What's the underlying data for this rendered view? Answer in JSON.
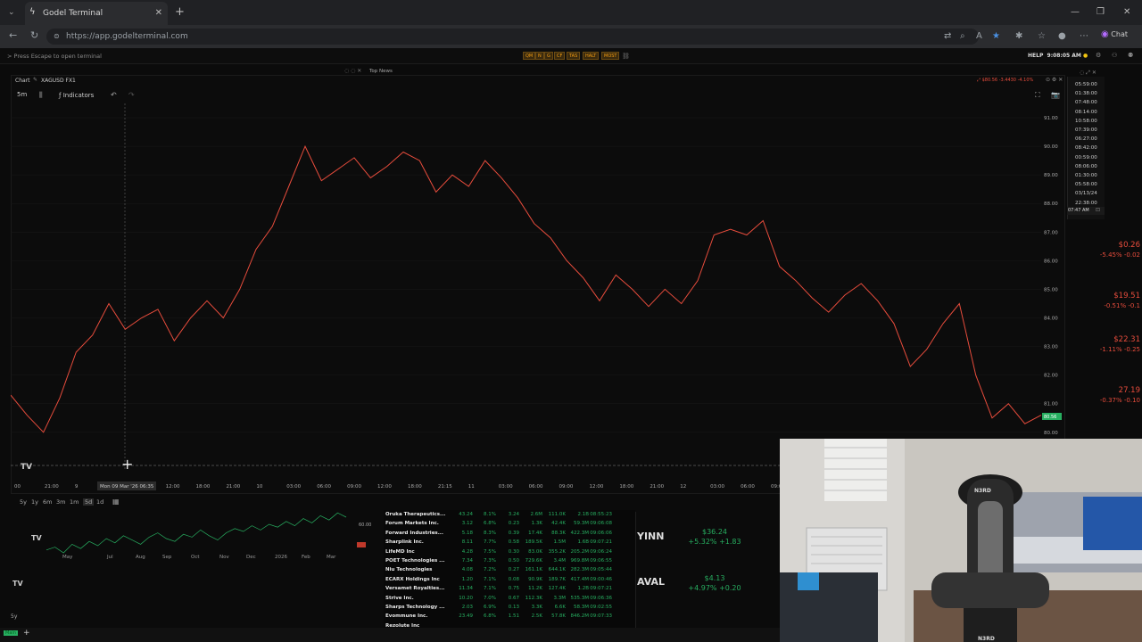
{
  "browser": {
    "tab_title": "Godel Terminal",
    "url": "https://app.godelterminal.com",
    "chat_label": "Chat"
  },
  "terminal": {
    "escape_hint": "Press Escape to open terminal",
    "toolbar_buttons": [
      "QM",
      "N",
      "G",
      "CF",
      "TAS",
      "HALT",
      "MOST"
    ],
    "help_label": "HELP",
    "clock": "9:08:05 AM",
    "top_news_label": "Top News"
  },
  "chart": {
    "panel_title": "Chart",
    "symbol": "XAGUSD FX1",
    "quote": "$80.56 -3.4430 -4.10%",
    "interval": "5m",
    "indicators_label": "Indicators",
    "crosshair_label": "Mon 09 Mar '26  06:35",
    "x_ticks": [
      "00",
      "21:00",
      "9",
      "03:00",
      "06:35",
      "12:00",
      "18:00",
      "21:00",
      "10",
      "03:00",
      "06:00",
      "09:00",
      "12:00",
      "18:00",
      "21:15",
      "11",
      "03:00",
      "06:00",
      "09:00",
      "12:00",
      "18:00",
      "21:00",
      "12",
      "03:00",
      "06:00",
      "09:00"
    ],
    "y_ticks": [
      "91.00",
      "90.00",
      "89.00",
      "88.00",
      "87.00",
      "86.00",
      "85.00",
      "84.00",
      "83.00",
      "82.00",
      "81.00",
      "80.00"
    ],
    "last_price_label": "80.56"
  },
  "chart_data": {
    "type": "line",
    "ylim": [
      79.9,
      91.5
    ],
    "y_ticks": [
      91,
      90,
      89,
      88,
      87,
      86,
      85,
      84,
      83,
      82,
      81,
      80
    ],
    "series": [
      {
        "values": [
          81.3,
          80.6,
          80.0,
          81.2,
          82.8,
          83.4,
          84.5,
          83.6,
          84.0,
          84.3,
          83.2,
          84.0,
          84.6,
          84.0,
          85.0,
          86.4,
          87.2,
          88.6,
          90.0,
          88.8,
          89.2,
          89.6,
          88.9,
          89.3,
          89.8,
          89.5,
          88.4,
          89.0,
          88.6,
          89.5,
          88.9,
          88.2,
          87.3,
          86.8,
          86.0,
          85.4,
          84.6,
          85.5,
          85.0,
          84.4,
          85.0,
          84.5,
          85.3,
          86.9,
          87.1,
          86.9,
          87.4,
          85.8,
          85.3,
          84.7,
          84.2,
          84.8,
          85.2,
          84.6,
          83.8,
          82.3,
          82.9,
          83.8,
          84.5,
          82.0,
          80.5,
          81.0,
          80.3,
          80.6
        ]
      }
    ]
  },
  "right_list": {
    "times": [
      "05:59:00",
      "01:38:00",
      "07:48:00",
      "08:14:00",
      "10:58:00",
      "07:39:00",
      "06:27:00",
      "08:42:00",
      "00:59:00",
      "08:06:00",
      "01:30:00",
      "05:58:00",
      "03/13/24",
      "22:38:00"
    ],
    "footer_time": "07:47 AM"
  },
  "right_quotes": [
    {
      "price": "$0.26",
      "change": "-5.45% -0.02"
    },
    {
      "price": "$19.51",
      "change": "-0.51% -0.1"
    },
    {
      "price": "$22.31",
      "change": "-1.11% -0.25"
    },
    {
      "price": "27.19",
      "change": "-0.37% -0.10"
    }
  ],
  "mini_chart": {
    "ranges": [
      "5y",
      "1y",
      "6m",
      "3m",
      "1m",
      "5d",
      "1d"
    ],
    "months": [
      "May",
      "Jul",
      "Aug",
      "Sep",
      "Oct",
      "Nov",
      "Dec",
      "2026",
      "Feb",
      "Mar"
    ],
    "y_label": "60.00"
  },
  "movers_table": {
    "rows": [
      [
        "Oruka Therapeutics...",
        "43.24",
        "8.1%",
        "3.24",
        "2.6M",
        "111.0K",
        "2.1B",
        "08:55:23"
      ],
      [
        "Forum Markets Inc.",
        "3.12",
        "6.8%",
        "0.23",
        "1.3K",
        "42.4K",
        "59.3M",
        "09:06:08"
      ],
      [
        "Forward Industries...",
        "5.18",
        "8.3%",
        "0.39",
        "17.4K",
        "88.3K",
        "422.3M",
        "09:06:06"
      ],
      [
        "Sharplink Inc.",
        "8.11",
        "7.7%",
        "0.58",
        "189.5K",
        "1.5M",
        "1.6B",
        "09:07:21"
      ],
      [
        "LifeMD Inc",
        "4.28",
        "7.5%",
        "0.30",
        "83.0K",
        "355.2K",
        "205.2M",
        "09:06:24"
      ],
      [
        "POET Technologies ...",
        "7.34",
        "7.3%",
        "0.50",
        "729.6K",
        "3.4M",
        "969.8M",
        "09:06:55"
      ],
      [
        "Niu Technologies",
        "4.08",
        "7.2%",
        "0.27",
        "161.1K",
        "644.1K",
        "282.3M",
        "09:05:44"
      ],
      [
        "ECARX Holdings Inc",
        "1.20",
        "7.1%",
        "0.08",
        "90.9K",
        "189.7K",
        "417.4M",
        "09:00:46"
      ],
      [
        "Versamet Royalties...",
        "11.34",
        "7.1%",
        "0.75",
        "11.2K",
        "127.4K",
        "1.2B",
        "09:07:21"
      ],
      [
        "Strive Inc.",
        "10.20",
        "7.0%",
        "0.67",
        "112.3K",
        "3.3M",
        "535.3M",
        "09:06:36"
      ],
      [
        "Sharps Technology ...",
        "2.03",
        "6.9%",
        "0.13",
        "3.3K",
        "6.6K",
        "58.3M",
        "09:02:55"
      ],
      [
        "Evommune Inc.",
        "23.49",
        "6.8%",
        "1.51",
        "2.5K",
        "57.8K",
        "846.2M",
        "09:07:33"
      ],
      [
        "Rezolute Inc",
        "",
        "",
        "",
        "",
        "",
        "",
        ""
      ]
    ]
  },
  "tickers": [
    {
      "symbol": "YINN",
      "price": "$36.24",
      "change": "+5.32% +1.83"
    },
    {
      "symbol": "AVAL",
      "price": "$4.13",
      "change": "+4.97% +0.20"
    }
  ],
  "bottom_bar": {
    "main_label": "Main"
  },
  "colors": {
    "up": "#27ae60",
    "down": "#e74c3c",
    "accent": "#f39c12"
  }
}
